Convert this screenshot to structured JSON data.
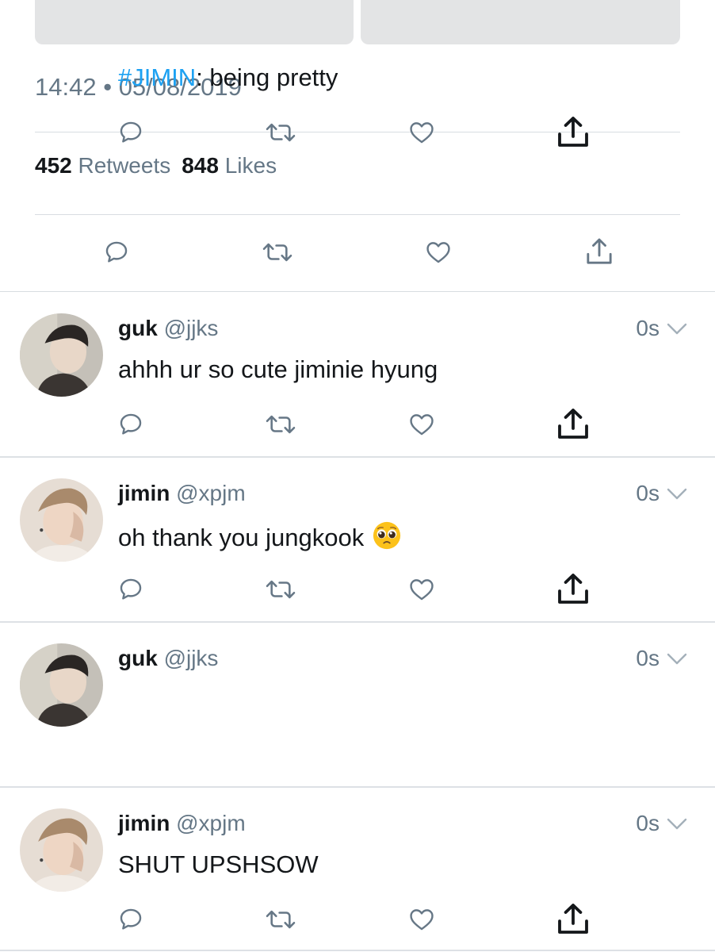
{
  "tweet": {
    "time": "14:42",
    "separator": "•",
    "date": "05/08/2019",
    "retweet_count": "452",
    "retweet_label": "Retweets",
    "like_count": "848",
    "like_label": "Likes"
  },
  "icons": {
    "reply": "reply-icon",
    "retweet": "retweet-icon",
    "like": "heart-icon",
    "share": "share-icon",
    "chevron": "chevron-down-icon",
    "emoji": "pleading-face-emoji"
  },
  "colors": {
    "text": "#14171a",
    "secondary": "#657786",
    "hashtag": "#1da1f2",
    "divider": "#d8dde1"
  },
  "replies": [
    {
      "name": "guk",
      "handle": "@jjks",
      "time": "0s",
      "text": "ahhh ur so cute jiminie hyung"
    },
    {
      "name": "jimin",
      "handle": "@xpjm",
      "time": "0s",
      "text": "oh thank you jungkook",
      "emoji": "🥺"
    },
    {
      "name": "guk",
      "handle": "@jjks",
      "time": "0s",
      "hashtag": "#JIMIN",
      "text": ": being pretty"
    },
    {
      "name": "jimin",
      "handle": "@xpjm",
      "time": "0s",
      "text": "SHUT UPSHSOW"
    }
  ]
}
